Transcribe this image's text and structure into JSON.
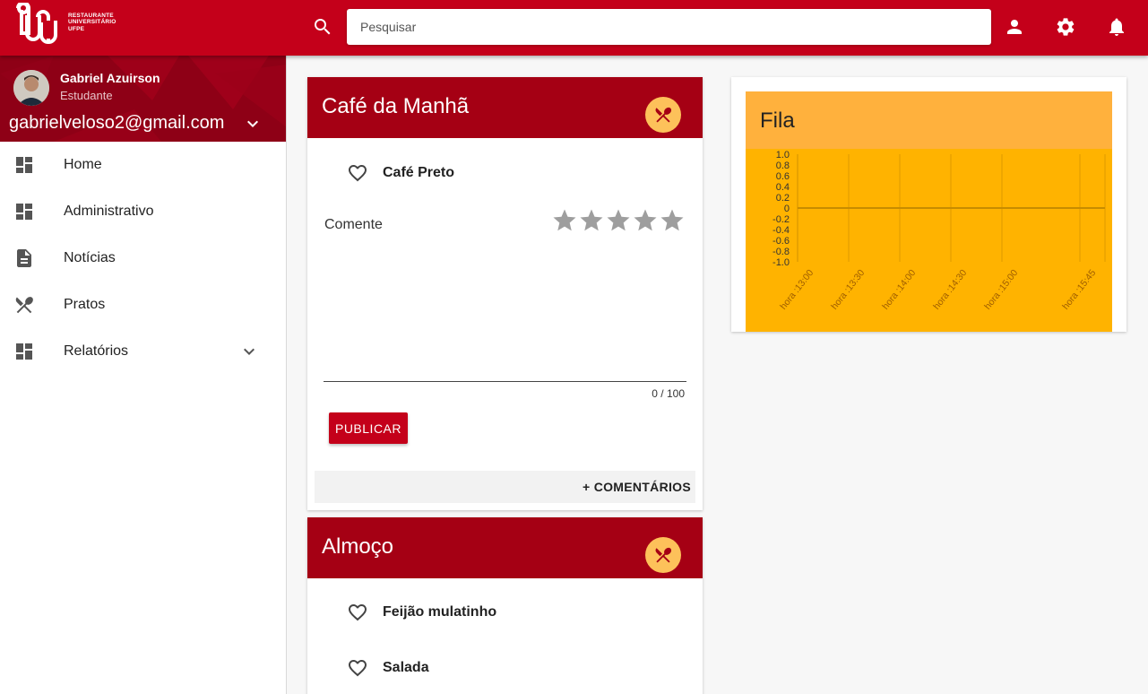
{
  "app": {
    "logo_text": [
      "RESTAURANTE",
      "UNIVERSITÁRIO",
      "UFPE"
    ],
    "brand_color": "#c4001a"
  },
  "search": {
    "placeholder": "Pesquisar",
    "value": ""
  },
  "topbar_icons": [
    "search-icon",
    "account-icon",
    "settings-icon",
    "notifications-icon"
  ],
  "user": {
    "name": "Gabriel Azuirson",
    "role": "Estudante",
    "email": "gabrielveloso2@gmail.com"
  },
  "nav": {
    "items": [
      {
        "label": "Home",
        "icon": "dashboard-icon"
      },
      {
        "label": "Administrativo",
        "icon": "dashboard-icon"
      },
      {
        "label": "Notícias",
        "icon": "document-icon"
      },
      {
        "label": "Pratos",
        "icon": "utensils-icon"
      },
      {
        "label": "Relatórios",
        "icon": "dashboard-icon",
        "expandable": true
      }
    ]
  },
  "meals": {
    "breakfast": {
      "title": "Café da Manhã",
      "dishes": [
        "Café Preto"
      ],
      "comment_label": "Comente",
      "rating": 0,
      "rating_max": 5,
      "comment_value": "",
      "counter": "0 / 100",
      "publish_label": "PUBLICAR",
      "more_label": "+ COMENTÁRIOS"
    },
    "lunch": {
      "title": "Almoço",
      "dishes": [
        "Feijão mulatinho",
        "Salada"
      ]
    }
  },
  "fila": {
    "title": "Fila",
    "chart_data": {
      "type": "line",
      "title": "",
      "x": [
        "hora :13:00",
        "hora :13:30",
        "hora :14:00",
        "hora :14:30",
        "hora :15:00",
        "hora :15:45"
      ],
      "yticks": [
        "1.0",
        "0.8",
        "0.6",
        "0.4",
        "0.2",
        "0",
        "-0.2",
        "-0.4",
        "-0.6",
        "-0.8",
        "-1.0"
      ],
      "ylim": [
        -1.0,
        1.0
      ],
      "series": [],
      "grid": true,
      "background": "#ffb300"
    }
  }
}
